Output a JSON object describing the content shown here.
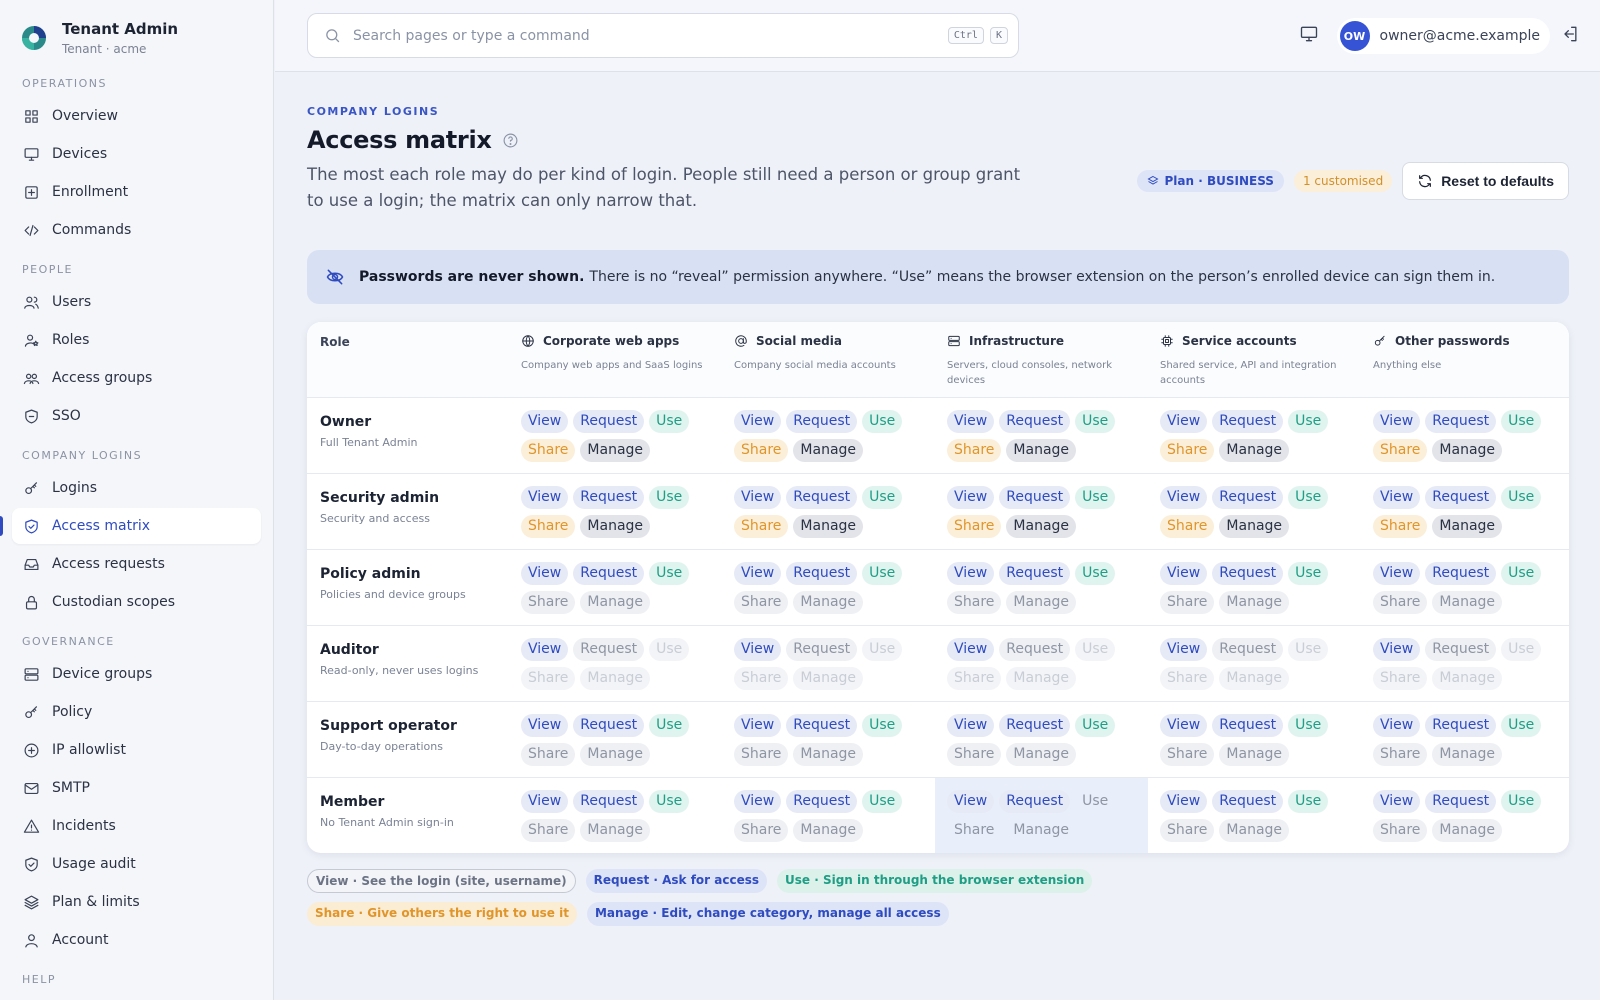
{
  "app": {
    "name": "Tenant Admin",
    "tenant": "Tenant · acme"
  },
  "sidebar": {
    "sections": [
      {
        "title": "OPERATIONS",
        "items": [
          {
            "label": "Overview",
            "icon": "grid-icon"
          },
          {
            "label": "Devices",
            "icon": "monitor-icon"
          },
          {
            "label": "Enrollment",
            "icon": "plus-square-icon"
          },
          {
            "label": "Commands",
            "icon": "code-icon"
          }
        ]
      },
      {
        "title": "PEOPLE",
        "items": [
          {
            "label": "Users",
            "icon": "users-icon"
          },
          {
            "label": "Roles",
            "icon": "user-star-icon"
          },
          {
            "label": "Access groups",
            "icon": "group-icon"
          },
          {
            "label": "SSO",
            "icon": "shield-minus-icon"
          }
        ]
      },
      {
        "title": "COMPANY LOGINS",
        "items": [
          {
            "label": "Logins",
            "icon": "key-icon"
          },
          {
            "label": "Access matrix",
            "icon": "shield-check-icon",
            "active": true
          },
          {
            "label": "Access requests",
            "icon": "inbox-icon"
          },
          {
            "label": "Custodian scopes",
            "icon": "lock-icon"
          }
        ]
      },
      {
        "title": "GOVERNANCE",
        "items": [
          {
            "label": "Device groups",
            "icon": "server-icon"
          },
          {
            "label": "Policy",
            "icon": "key-icon"
          },
          {
            "label": "IP allowlist",
            "icon": "plus-circle-icon"
          },
          {
            "label": "SMTP",
            "icon": "mail-icon"
          },
          {
            "label": "Incidents",
            "icon": "alert-triangle-icon"
          },
          {
            "label": "Usage audit",
            "icon": "shield-check-icon"
          },
          {
            "label": "Plan & limits",
            "icon": "layers-icon"
          },
          {
            "label": "Account",
            "icon": "user-icon"
          }
        ]
      },
      {
        "title": "HELP",
        "items": []
      }
    ]
  },
  "topbar": {
    "search_placeholder": "Search pages or type a command",
    "kbd1": "Ctrl",
    "kbd2": "K",
    "avatar_initials": "OW",
    "user_email": "owner@acme.example"
  },
  "page": {
    "eyebrow": "COMPANY LOGINS",
    "title": "Access matrix",
    "description": "The most each role may do per kind of login. People still need a person or group grant to use a login; the matrix can only narrow that.",
    "plan_badge": "Plan · BUSINESS",
    "customised_badge": "1 customised",
    "reset_label": "Reset to defaults",
    "notice_bold": "Passwords are never shown.",
    "notice_text": "There is no “reveal” permission anywhere. “Use” means the browser extension on the person’s enrolled device can sign them in."
  },
  "colors": {
    "accent": "#2f4bbf",
    "use": "#1f9e85",
    "share": "#e0952b",
    "notice_bg": "#d8e0f3"
  },
  "matrix": {
    "role_header": "Role",
    "permissions": [
      "View",
      "Request",
      "Use",
      "Share",
      "Manage"
    ],
    "categories": [
      {
        "name": "Corporate web apps",
        "desc": "Company web apps and SaaS logins",
        "icon": "globe-icon"
      },
      {
        "name": "Social media",
        "desc": "Company social media accounts",
        "icon": "at-sign-icon"
      },
      {
        "name": "Infrastructure",
        "desc": "Servers, cloud consoles, network devices",
        "icon": "server-icon"
      },
      {
        "name": "Service accounts",
        "desc": "Shared service, API and integration accounts",
        "icon": "cpu-icon"
      },
      {
        "name": "Other passwords",
        "desc": "Anything else",
        "icon": "key-icon"
      }
    ],
    "roles": [
      {
        "name": "Owner",
        "desc": "Full Tenant Admin",
        "cells": [
          [
            "on",
            "on",
            "on",
            "on",
            "on"
          ],
          [
            "on",
            "on",
            "on",
            "on",
            "on"
          ],
          [
            "on",
            "on",
            "on",
            "on",
            "on"
          ],
          [
            "on",
            "on",
            "on",
            "on",
            "on"
          ],
          [
            "on",
            "on",
            "on",
            "on",
            "on"
          ]
        ]
      },
      {
        "name": "Security admin",
        "desc": "Security and access",
        "cells": [
          [
            "on",
            "on",
            "on",
            "on",
            "on"
          ],
          [
            "on",
            "on",
            "on",
            "on",
            "on"
          ],
          [
            "on",
            "on",
            "on",
            "on",
            "on"
          ],
          [
            "on",
            "on",
            "on",
            "on",
            "on"
          ],
          [
            "on",
            "on",
            "on",
            "on",
            "on"
          ]
        ]
      },
      {
        "name": "Policy admin",
        "desc": "Policies and device groups",
        "cells": [
          [
            "on",
            "on",
            "on",
            "off",
            "off"
          ],
          [
            "on",
            "on",
            "on",
            "off",
            "off"
          ],
          [
            "on",
            "on",
            "on",
            "off",
            "off"
          ],
          [
            "on",
            "on",
            "on",
            "off",
            "off"
          ],
          [
            "on",
            "on",
            "on",
            "off",
            "off"
          ]
        ]
      },
      {
        "name": "Auditor",
        "desc": "Read-only, never uses logins",
        "cells": [
          [
            "on",
            "off",
            "na",
            "na",
            "na"
          ],
          [
            "on",
            "off",
            "na",
            "na",
            "na"
          ],
          [
            "on",
            "off",
            "na",
            "na",
            "na"
          ],
          [
            "on",
            "off",
            "na",
            "na",
            "na"
          ],
          [
            "on",
            "off",
            "na",
            "na",
            "na"
          ]
        ]
      },
      {
        "name": "Support operator",
        "desc": "Day-to-day operations",
        "cells": [
          [
            "on",
            "on",
            "on",
            "off",
            "off"
          ],
          [
            "on",
            "on",
            "on",
            "off",
            "off"
          ],
          [
            "on",
            "on",
            "on",
            "off",
            "off"
          ],
          [
            "on",
            "on",
            "on",
            "off",
            "off"
          ],
          [
            "on",
            "on",
            "on",
            "off",
            "off"
          ]
        ]
      },
      {
        "name": "Member",
        "desc": "No Tenant Admin sign-in",
        "cells": [
          [
            "on",
            "on",
            "on",
            "off",
            "off"
          ],
          [
            "on",
            "on",
            "on",
            "off",
            "off"
          ],
          [
            "on",
            "on",
            "plain",
            "plain",
            "plain"
          ],
          [
            "on",
            "on",
            "on",
            "off",
            "off"
          ],
          [
            "on",
            "on",
            "on",
            "off",
            "off"
          ]
        ],
        "highlight": 2
      }
    ]
  },
  "legend": [
    {
      "label": "View · See the login (site, username)",
      "cls": "lg-view"
    },
    {
      "label": "Request · Ask for access",
      "cls": "lg-request"
    },
    {
      "label": "Use · Sign in through the browser extension",
      "cls": "lg-use"
    },
    {
      "label": "Share · Give others the right to use it",
      "cls": "lg-share"
    },
    {
      "label": "Manage · Edit, change category, manage all access",
      "cls": "lg-manage"
    }
  ]
}
